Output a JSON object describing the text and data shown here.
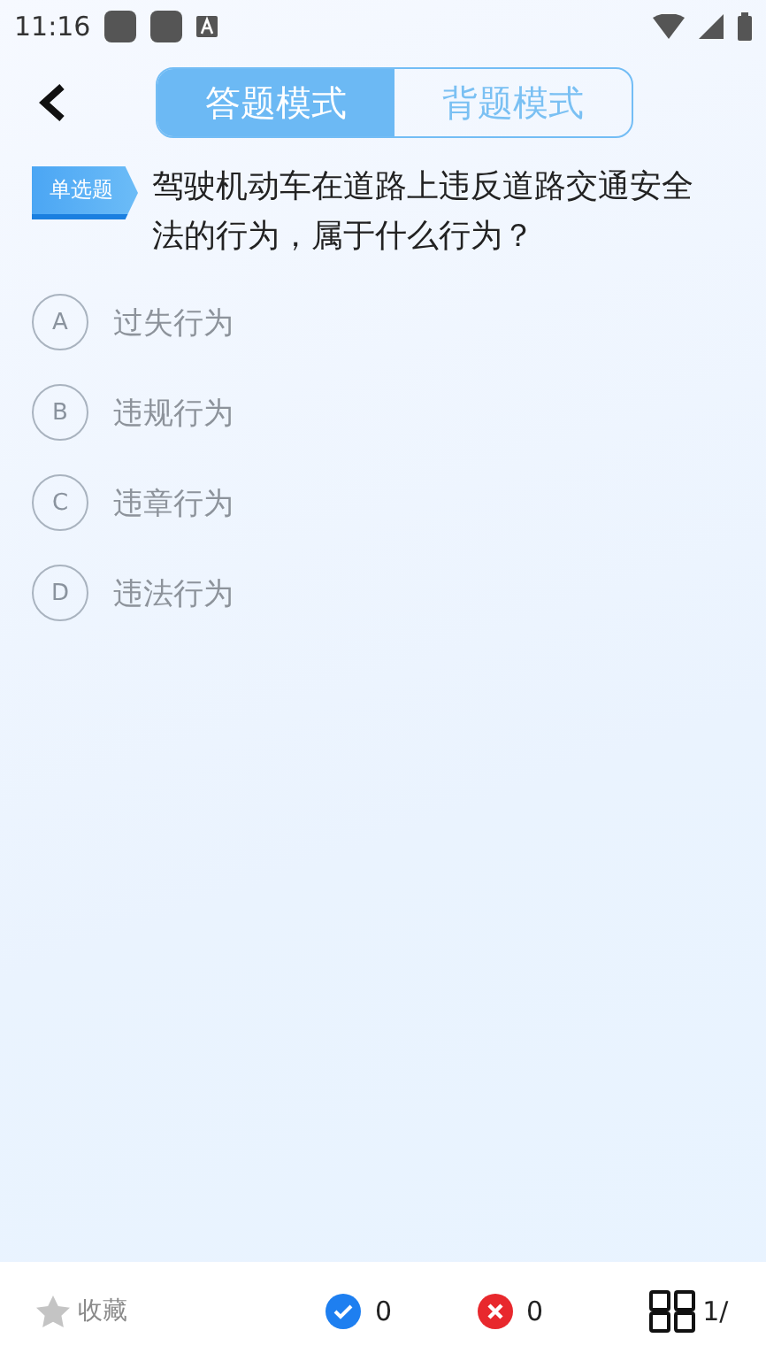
{
  "status_bar": {
    "time": "11:16"
  },
  "mode_tabs": [
    {
      "label": "答题模式",
      "selected": true
    },
    {
      "label": "背题模式",
      "selected": false
    }
  ],
  "question": {
    "type_tag": "单选题",
    "text": "驾驶机动车在道路上违反道路交通安全法的行为，属于什么行为？"
  },
  "options": [
    {
      "letter": "A",
      "text": "过失行为",
      "selected": false
    },
    {
      "letter": "B",
      "text": "违规行为",
      "selected": false
    },
    {
      "letter": "C",
      "text": "违章行为",
      "selected": false
    },
    {
      "letter": "D",
      "text": "违法行为",
      "selected": false
    }
  ],
  "bottom_bar": {
    "favorite": "收藏",
    "correct_count": "0",
    "wrong_count": "0",
    "progress": "1/"
  }
}
